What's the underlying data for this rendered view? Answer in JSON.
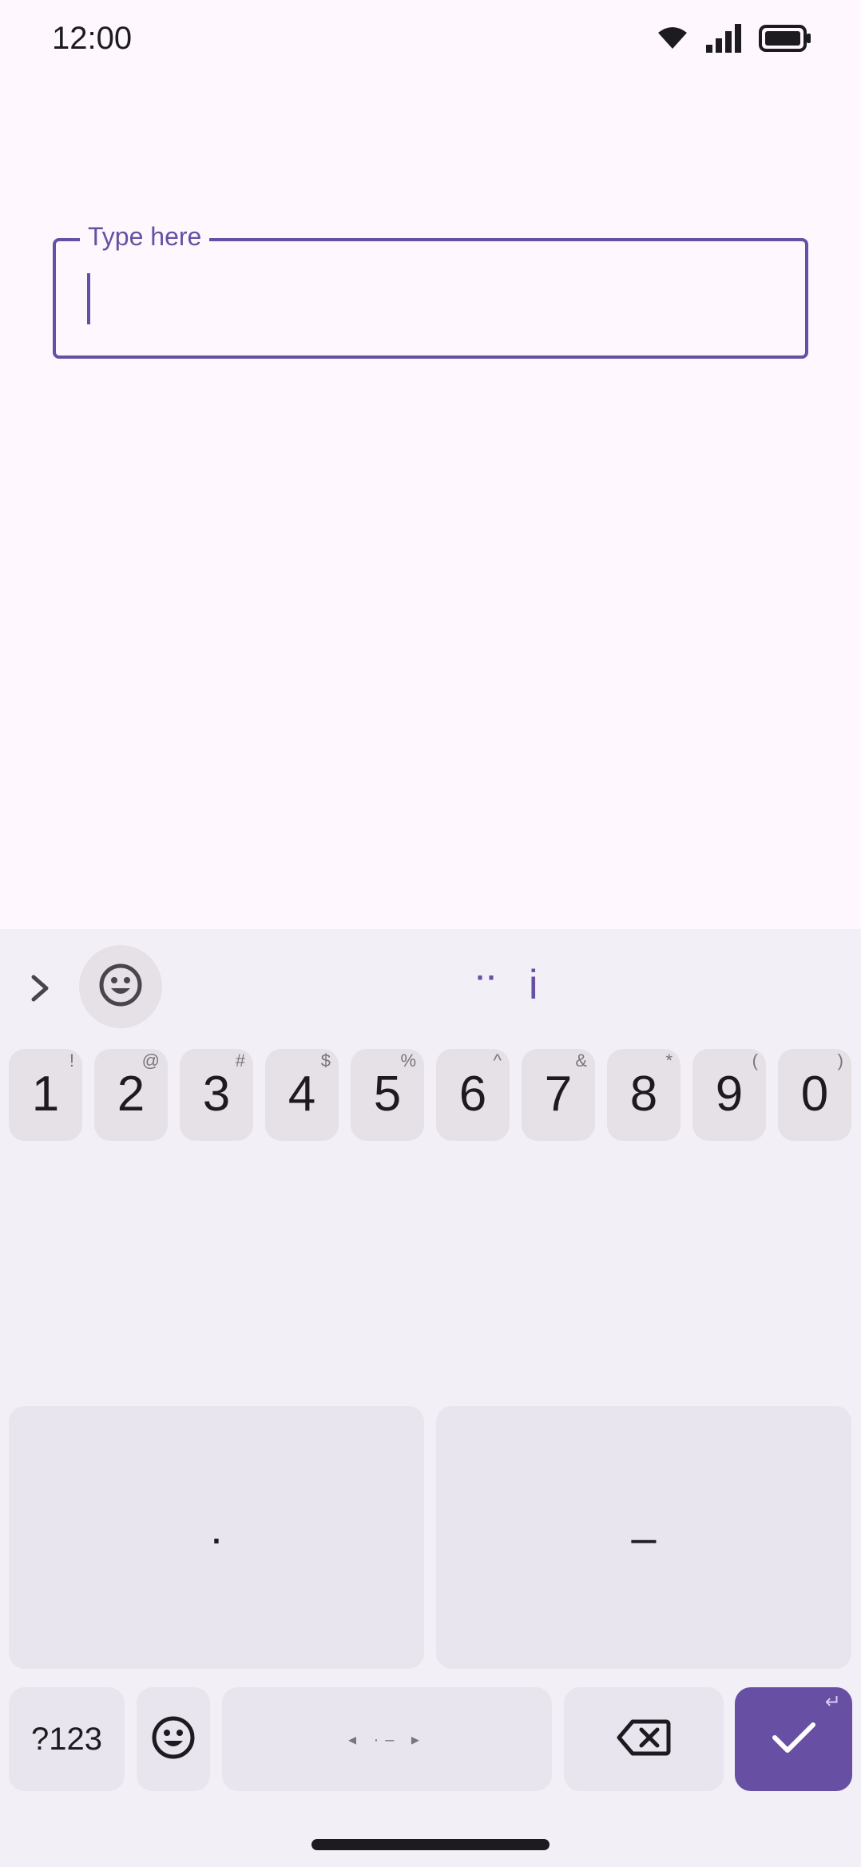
{
  "status_bar": {
    "time": "12:00",
    "icons": [
      "wifi-icon",
      "signal-icon",
      "battery-icon"
    ]
  },
  "field": {
    "label": "Type here",
    "value": ""
  },
  "keyboard": {
    "toolbar": {
      "expand_icon": "chevron-right-icon",
      "emoji_icon": "emoji-icon",
      "suggestion_dots": "··",
      "suggestion_i": "i"
    },
    "number_row": [
      {
        "key": "1",
        "alt": "!"
      },
      {
        "key": "2",
        "alt": "@"
      },
      {
        "key": "3",
        "alt": "#"
      },
      {
        "key": "4",
        "alt": "$"
      },
      {
        "key": "5",
        "alt": "%"
      },
      {
        "key": "6",
        "alt": "^"
      },
      {
        "key": "7",
        "alt": "&"
      },
      {
        "key": "8",
        "alt": "*"
      },
      {
        "key": "9",
        "alt": "("
      },
      {
        "key": "0",
        "alt": ")"
      }
    ],
    "big_keys": {
      "left": "·",
      "right": "–"
    },
    "bottom_row": {
      "symbols": "?123",
      "space": "◂ ·– ▸"
    },
    "colors": {
      "accent": "#6750a4",
      "background": "#f3eff6",
      "key": "#e6e1e6"
    }
  }
}
